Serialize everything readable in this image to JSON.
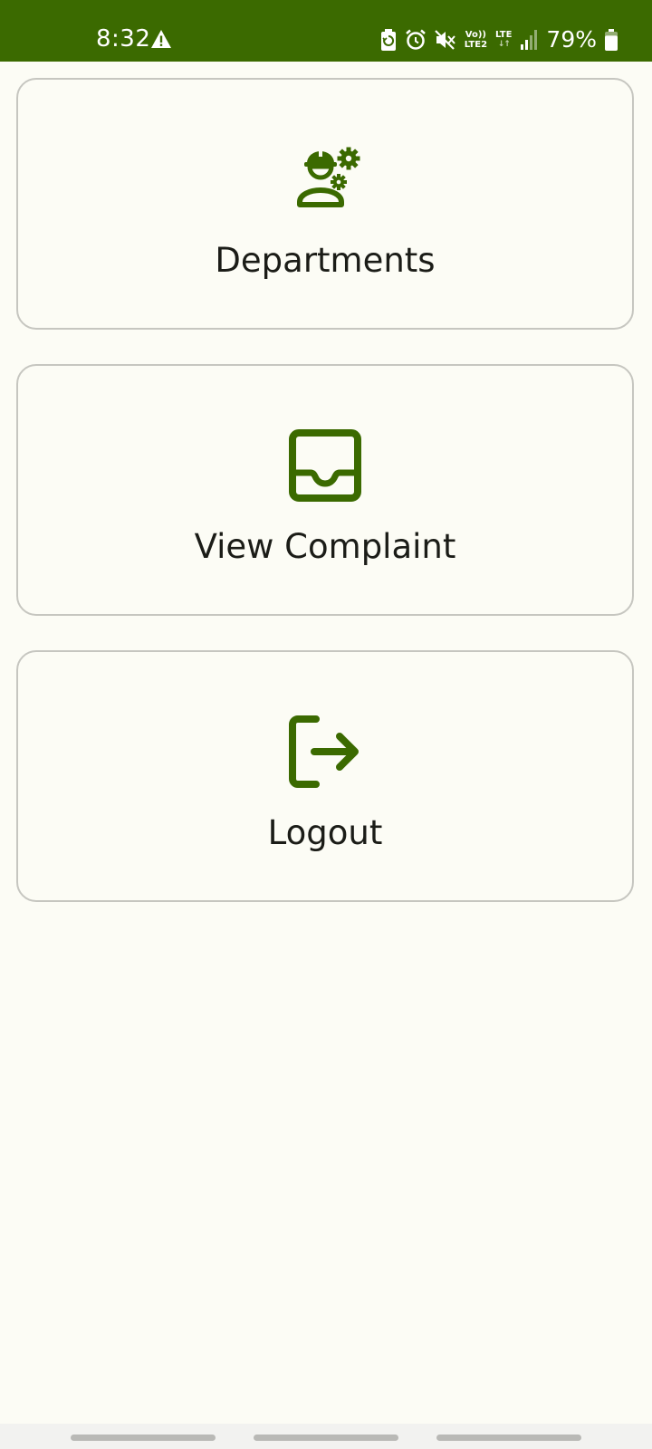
{
  "status_bar": {
    "time": "8:32",
    "volte_top": "Vo))",
    "volte_bottom": "LTE2",
    "lte_top": "LTE",
    "lte_bottom": "↓↑",
    "battery_percent": "79%",
    "battery_level": 0.79,
    "background_color": "#3b6a00"
  },
  "menu": {
    "accent_color": "#3b6a00",
    "items": [
      {
        "label": "Departments",
        "icon": "engineer-gears-icon"
      },
      {
        "label": "View Complaint",
        "icon": "inbox-tray-icon"
      },
      {
        "label": "Logout",
        "icon": "logout-icon"
      }
    ]
  }
}
